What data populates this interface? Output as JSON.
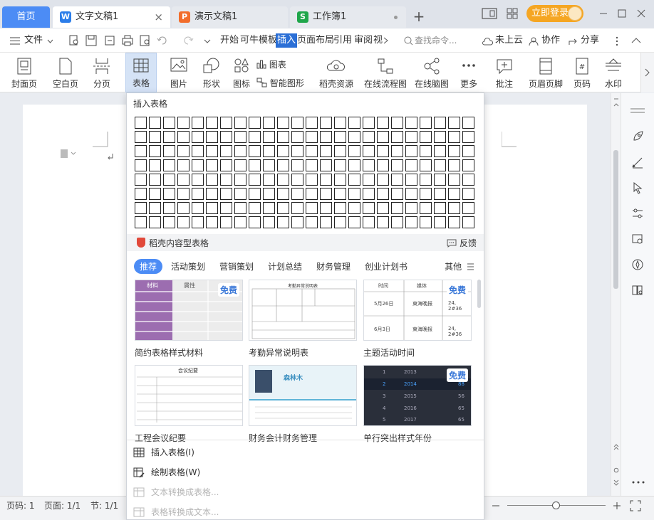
{
  "tabbar": {
    "home": "首页",
    "tabs": [
      {
        "label": "文字文稿1",
        "icon": "W",
        "color": "#2b7de9",
        "close": "×"
      },
      {
        "label": "演示文稿1",
        "icon": "P",
        "color": "#f26d2b"
      },
      {
        "label": "工作簿1",
        "icon": "S",
        "color": "#1fa64a"
      }
    ],
    "new_tab": "+",
    "login": "立即登录",
    "login_color": "#f5a623"
  },
  "menubar": {
    "file": "文件",
    "items": [
      "开始",
      "可牛模板",
      "插入",
      "页面布局",
      "引用",
      "审阅",
      "视"
    ],
    "active": "插入",
    "search_placeholder": "查找命令...",
    "cloud": "未上云",
    "collab": "协作",
    "share": "分享"
  },
  "ribbon": {
    "cover": "封面页",
    "blank": "空白页",
    "break": "分页",
    "table": "表格",
    "picture": "图片",
    "shape": "形状",
    "icon": "图标",
    "chart": "图表",
    "smart": "智能图形",
    "daoke": "稻壳资源",
    "flow": "在线流程图",
    "mind": "在线脑图",
    "more": "更多",
    "comment": "批注",
    "header_footer": "页眉页脚",
    "page_num": "页码",
    "watermark": "水印"
  },
  "dropdown": {
    "title": "插入表格",
    "section_title": "稻壳内容型表格",
    "feedback": "反馈",
    "categories": [
      "推荐",
      "活动策划",
      "营销策划",
      "计划总结",
      "财务管理",
      "创业计划书"
    ],
    "more": "其他",
    "free_badge": "免费",
    "templates": [
      {
        "name": "简约表格样式材料"
      },
      {
        "name": "考勤异常说明表"
      },
      {
        "name": "主题活动时间"
      },
      {
        "name": "工程会议纪要"
      },
      {
        "name": "财务会计财务管理"
      },
      {
        "name": "单行突出样式年份"
      }
    ],
    "thumbnail_text": {
      "t1_headers": [
        "材料",
        "属性"
      ],
      "t2_title": "考勤异常说明表",
      "t3_headers": [
        "时间",
        "媒体",
        "内容"
      ],
      "t3_rows": [
        [
          "5月26日",
          "東海晚报",
          "24, 2#36"
        ],
        [
          "6月3日",
          "東海晚报",
          "24, 2#36"
        ]
      ],
      "t4_title": "会议纪要",
      "t5_name": "森林木",
      "t6_rows": [
        [
          "1",
          "2013",
          "65"
        ],
        [
          "2",
          "2014",
          "88"
        ],
        [
          "3",
          "2015",
          "56"
        ],
        [
          "4",
          "2016",
          "65"
        ],
        [
          "5",
          "2017",
          "65"
        ]
      ]
    },
    "actions": [
      {
        "label": "插入表格(I)",
        "enabled": true
      },
      {
        "label": "绘制表格(W)",
        "enabled": true
      },
      {
        "label": "文本转换成表格...",
        "enabled": false
      },
      {
        "label": "表格转换成文本...",
        "enabled": false
      }
    ]
  },
  "statusbar": {
    "page_code": "页码: 1",
    "page": "页面: 1/1",
    "section": "节: 1/1"
  }
}
